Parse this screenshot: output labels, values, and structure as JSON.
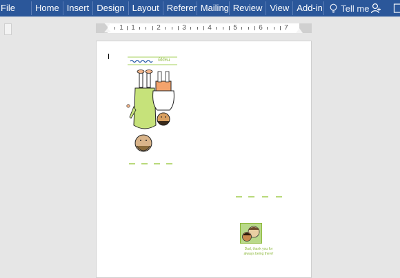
{
  "ribbon": {
    "tabs": [
      "File",
      "Home",
      "Insert",
      "Design",
      "Layout",
      "Referer",
      "Mailing",
      "Review",
      "View",
      "Add-in"
    ],
    "tell_me": "Tell me"
  },
  "ruler": {
    "numbers": [
      "1",
      "1",
      "2",
      "3",
      "4",
      "5",
      "6",
      "7"
    ]
  },
  "document": {
    "card_title": "Happy",
    "card_message": "Dad, thank you for always being there!"
  },
  "colors": {
    "ribbon_blue": "#2b579a",
    "accent_green": "#8cb83a"
  },
  "icons": [
    "lightbulb-icon",
    "share-person-icon"
  ]
}
